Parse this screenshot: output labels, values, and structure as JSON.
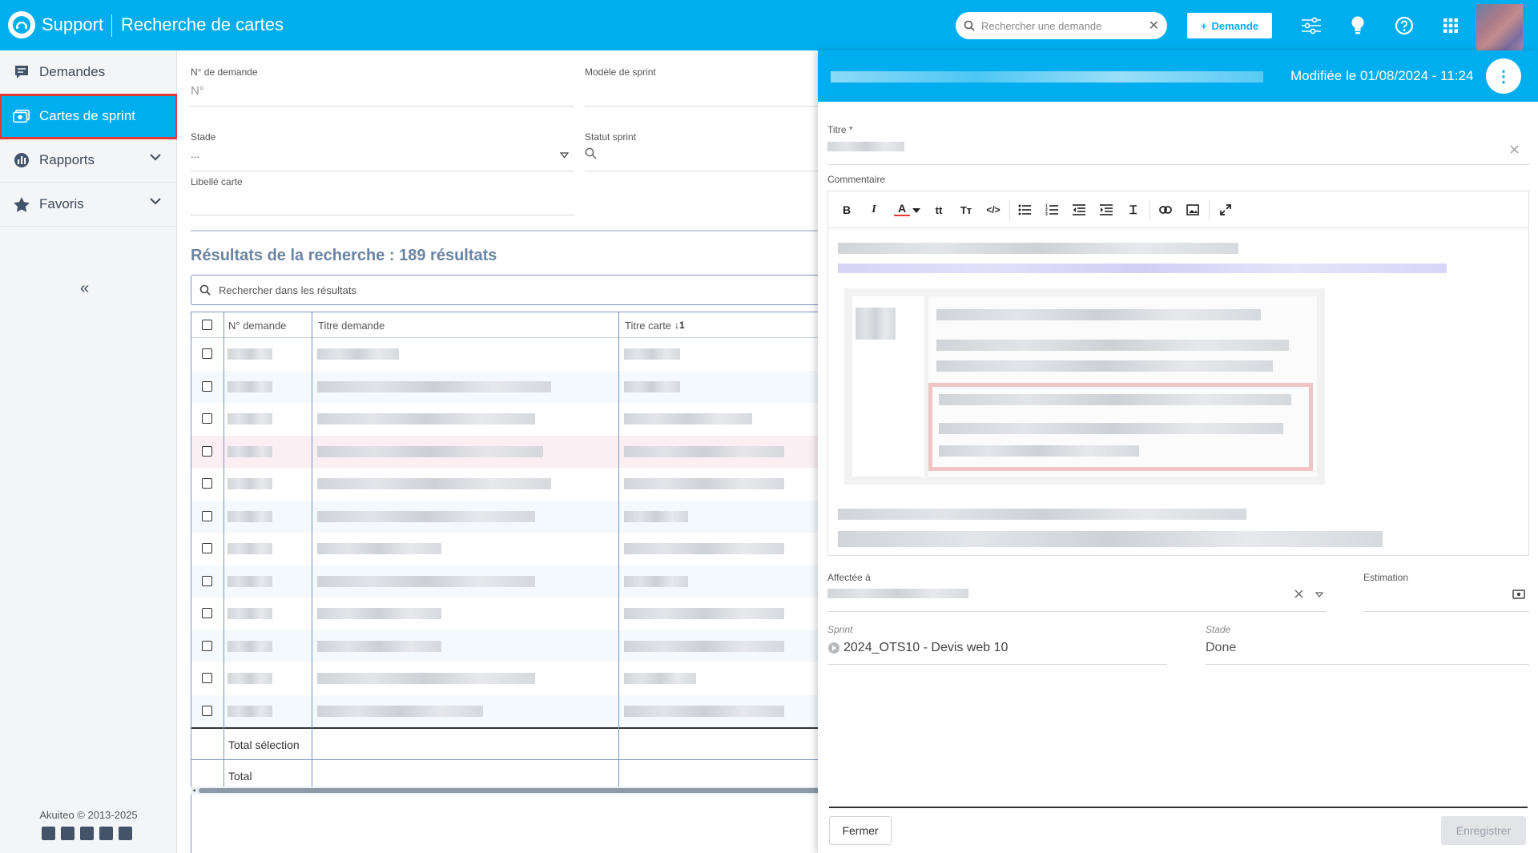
{
  "header": {
    "app_name": "Support",
    "page_title": "Recherche de cartes",
    "search_placeholder": "Rechercher une demande",
    "new_button_label": "Demande",
    "colors": {
      "primary": "#00aeef",
      "accent": "#e53935"
    }
  },
  "sidebar": {
    "items": [
      {
        "label": "Demandes",
        "icon": "chat-icon"
      },
      {
        "label": "Cartes de sprint",
        "icon": "cards-icon"
      },
      {
        "label": "Rapports",
        "icon": "chart-icon"
      },
      {
        "label": "Favoris",
        "icon": "star-icon"
      }
    ],
    "collapse_glyph": "«",
    "footer": "Akuiteo © 2013-2025"
  },
  "filters": {
    "request_no_label": "N° de demande",
    "request_no_placeholder": "N°",
    "sprint_model_label": "Modèle de sprint",
    "stage_label": "Stade",
    "stage_value": "...",
    "sprint_status_label": "Statut sprint",
    "card_label_label": "Libellé carte"
  },
  "results": {
    "title": "Résultats de la recherche : 189 résultats",
    "search_placeholder": "Rechercher dans les résultats",
    "columns": [
      "N° demande",
      "Titre demande",
      "Titre carte"
    ],
    "sort_indicator": "↓1",
    "total_selection_label": "Total sélection",
    "total_label": "Total"
  },
  "panel": {
    "modified": "Modifiée le 01/08/2024 - 11:24",
    "title_label": "Titre *",
    "comment_label": "Commentaire",
    "assigned_label": "Affectée à",
    "estimation_label": "Estimation",
    "sprint_label": "Sprint",
    "sprint_value": "2024_OTS10 - Devis web 10",
    "stage_label": "Stade",
    "stage_value": "Done",
    "close_button": "Fermer",
    "save_button": "Enregistrer"
  }
}
